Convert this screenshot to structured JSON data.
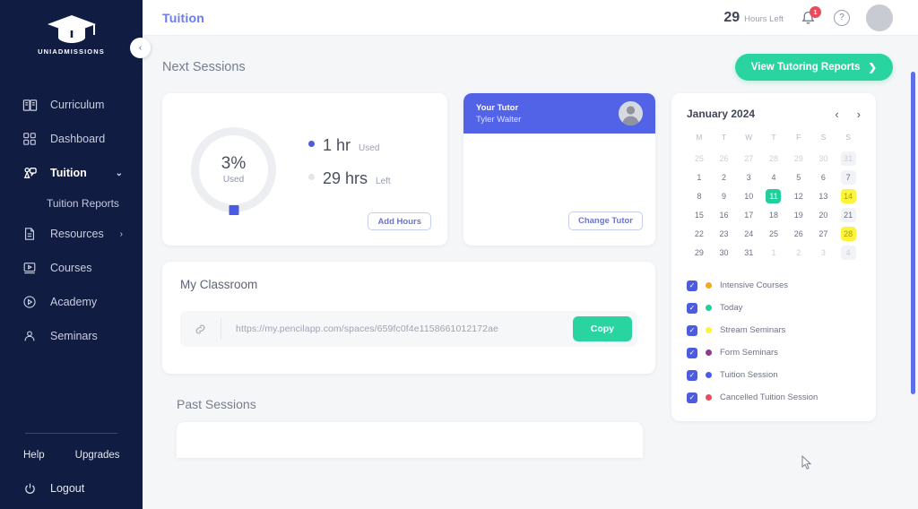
{
  "sidebar": {
    "brand": "UNIADMISSIONS",
    "items": [
      {
        "label": "Curriculum",
        "icon": "book-icon",
        "active": false
      },
      {
        "label": "Dashboard",
        "icon": "grid-icon",
        "active": false
      },
      {
        "label": "Tuition",
        "icon": "tuition-icon",
        "active": true,
        "chevron": "⌄"
      },
      {
        "label": "Resources",
        "icon": "document-icon",
        "active": false,
        "chevron": "›"
      },
      {
        "label": "Courses",
        "icon": "video-icon",
        "active": false
      },
      {
        "label": "Academy",
        "icon": "play-circle-icon",
        "active": false
      },
      {
        "label": "Seminars",
        "icon": "person-icon",
        "active": false
      }
    ],
    "sub_item": "Tuition Reports",
    "help": "Help",
    "upgrades": "Upgrades",
    "logout": "Logout",
    "collapse_icon": "‹"
  },
  "topbar": {
    "title": "Tuition",
    "hours_number": "29",
    "hours_label": "Hours Left",
    "notification_count": "1",
    "help_glyph": "?"
  },
  "next_sessions": {
    "title": "Next Sessions",
    "reports_button": "View Tutoring Reports",
    "reports_chevron": "❯"
  },
  "usage": {
    "percent": "3%",
    "percent_label": "Used",
    "used_value": "1 hr",
    "used_label": "Used",
    "left_value": "29 hrs",
    "left_label": "Left",
    "add_hours_button": "Add Hours",
    "used_color": "#4c5ce0",
    "left_color": "#e3e5ea"
  },
  "tutor": {
    "role": "Your Tutor",
    "name": "Tyler Walter",
    "change_button": "Change Tutor",
    "header_color": "#5363e8"
  },
  "classroom": {
    "title": "My Classroom",
    "link_icon": "link-icon",
    "url": "https://my.pencilapp.com/spaces/659fc0f4e1158661012172ae",
    "copy_button": "Copy"
  },
  "calendar": {
    "month": "January 2024",
    "prev_icon": "‹",
    "next_icon": "›",
    "dow": [
      "M",
      "T",
      "W",
      "T",
      "F",
      "S",
      "S"
    ],
    "weeks": [
      [
        {
          "d": "25",
          "muted": true
        },
        {
          "d": "26",
          "muted": true
        },
        {
          "d": "27",
          "muted": true
        },
        {
          "d": "28",
          "muted": true
        },
        {
          "d": "29",
          "muted": true
        },
        {
          "d": "30",
          "muted": true
        },
        {
          "d": "31",
          "muted": true,
          "style": "weekend"
        }
      ],
      [
        {
          "d": "1"
        },
        {
          "d": "2"
        },
        {
          "d": "3"
        },
        {
          "d": "4"
        },
        {
          "d": "5"
        },
        {
          "d": "6"
        },
        {
          "d": "7",
          "style": "weekend"
        }
      ],
      [
        {
          "d": "8"
        },
        {
          "d": "9"
        },
        {
          "d": "10"
        },
        {
          "d": "11",
          "style": "today"
        },
        {
          "d": "12"
        },
        {
          "d": "13"
        },
        {
          "d": "14",
          "style": "stream"
        }
      ],
      [
        {
          "d": "15"
        },
        {
          "d": "16"
        },
        {
          "d": "17"
        },
        {
          "d": "18"
        },
        {
          "d": "19"
        },
        {
          "d": "20"
        },
        {
          "d": "21",
          "style": "weekend"
        }
      ],
      [
        {
          "d": "22"
        },
        {
          "d": "23"
        },
        {
          "d": "24"
        },
        {
          "d": "25"
        },
        {
          "d": "26"
        },
        {
          "d": "27"
        },
        {
          "d": "28",
          "style": "stream"
        }
      ],
      [
        {
          "d": "29"
        },
        {
          "d": "30"
        },
        {
          "d": "31"
        },
        {
          "d": "1",
          "muted": true
        },
        {
          "d": "2",
          "muted": true
        },
        {
          "d": "3",
          "muted": true
        },
        {
          "d": "4",
          "muted": true,
          "style": "weekend"
        }
      ]
    ],
    "legend": [
      {
        "label": "Intensive Courses",
        "color": "#f5a623",
        "checked": true
      },
      {
        "label": "Today",
        "color": "#21cf9d",
        "checked": true
      },
      {
        "label": "Stream Seminars",
        "color": "#fbf43a",
        "checked": true
      },
      {
        "label": "Form Seminars",
        "color": "#8e3b8e",
        "checked": true
      },
      {
        "label": "Tuition Session",
        "color": "#4c5ce0",
        "checked": true
      },
      {
        "label": "Cancelled Tuition Session",
        "color": "#ea4b5c",
        "checked": true
      }
    ],
    "check_glyph": "✓"
  },
  "past_sessions": {
    "title": "Past Sessions"
  }
}
